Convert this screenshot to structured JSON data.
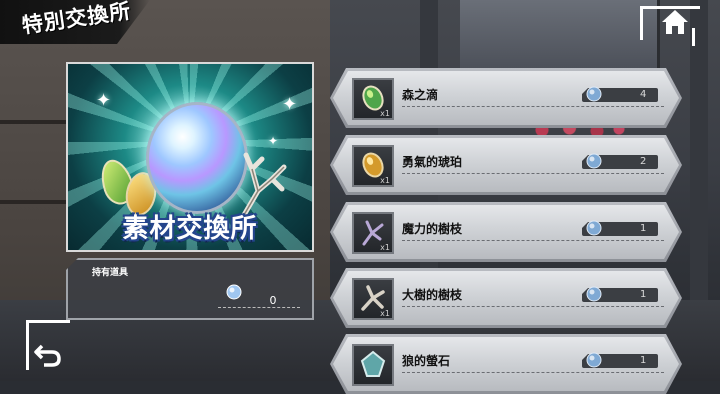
{
  "header": {
    "title": "特別交換所"
  },
  "banner": {
    "label": "素材交換所"
  },
  "held": {
    "title": "持有道具",
    "count": "0"
  },
  "items": [
    {
      "name": "森之滴",
      "qty": "x1",
      "cost": "4",
      "icon": "green-drop-gem-icon"
    },
    {
      "name": "勇氣的琥珀",
      "qty": "x1",
      "cost": "2",
      "icon": "amber-gem-icon"
    },
    {
      "name": "魔力的樹枝",
      "qty": "x1",
      "cost": "1",
      "icon": "magic-branch-icon"
    },
    {
      "name": "大樹的樹枝",
      "qty": "x1",
      "cost": "1",
      "icon": "tree-branch-icon"
    },
    {
      "name": "狼的螢石",
      "qty": "",
      "cost": "1",
      "icon": "wolf-fluorite-icon"
    }
  ],
  "colors": {
    "accent": "#2a4c8e",
    "teal": "#1d8a86"
  }
}
